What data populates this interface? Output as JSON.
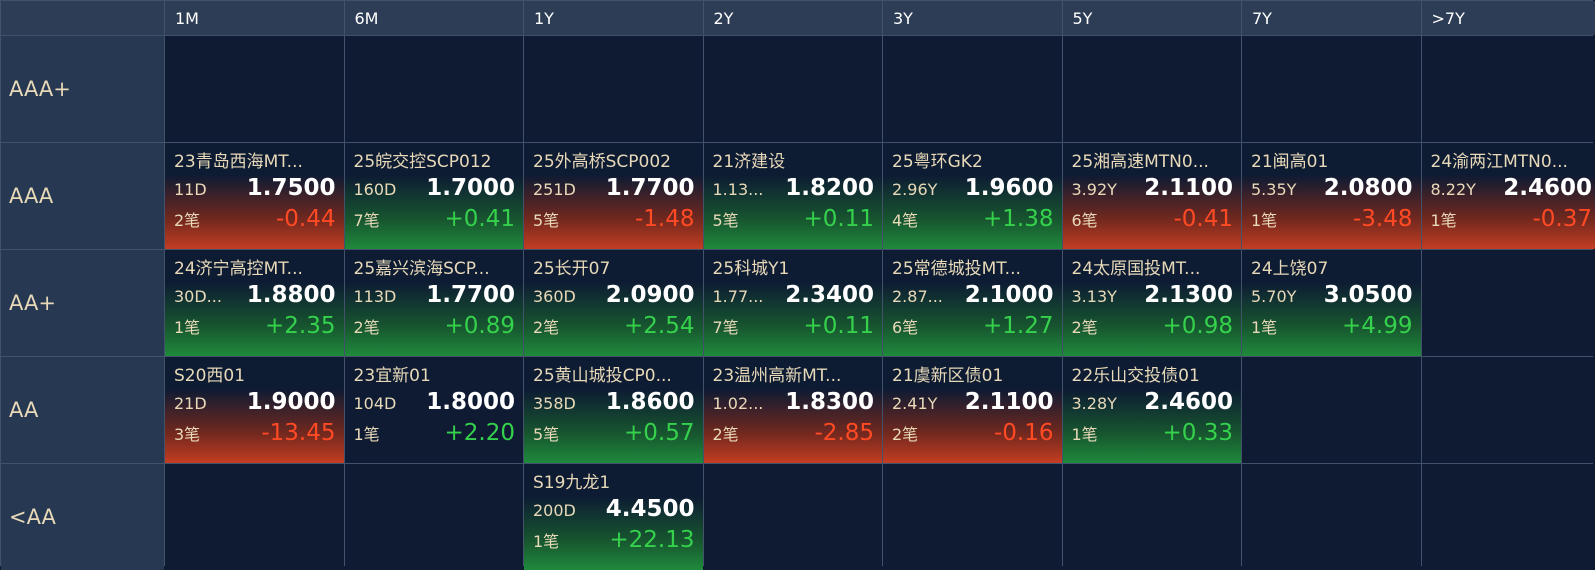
{
  "columns": [
    "1M",
    "6M",
    "1Y",
    "2Y",
    "3Y",
    "5Y",
    "7Y",
    ">7Y"
  ],
  "rows": [
    {
      "label": "AAA+",
      "cells": [
        null,
        null,
        null,
        null,
        null,
        null,
        null,
        null
      ]
    },
    {
      "label": "AAA",
      "cells": [
        {
          "name": "23青岛西海MT...",
          "term": "11D",
          "yield": "1.7500",
          "count": "2笔",
          "change": "-0.44",
          "dir": "down"
        },
        {
          "name": "25皖交控SCP012",
          "term": "160D",
          "yield": "1.7000",
          "count": "7笔",
          "change": "+0.41",
          "dir": "up"
        },
        {
          "name": "25外高桥SCP002",
          "term": "251D",
          "yield": "1.7700",
          "count": "5笔",
          "change": "-1.48",
          "dir": "down"
        },
        {
          "name": "21济建设",
          "term": "1.13...",
          "yield": "1.8200",
          "count": "5笔",
          "change": "+0.11",
          "dir": "up"
        },
        {
          "name": "25粤环GK2",
          "term": "2.96Y",
          "yield": "1.9600",
          "count": "4笔",
          "change": "+1.38",
          "dir": "up"
        },
        {
          "name": "25湘高速MTN0...",
          "term": "3.92Y",
          "yield": "2.1100",
          "count": "6笔",
          "change": "-0.41",
          "dir": "down"
        },
        {
          "name": "21闽高01",
          "term": "5.35Y",
          "yield": "2.0800",
          "count": "1笔",
          "change": "-3.48",
          "dir": "down"
        },
        {
          "name": "24渝两江MTN0...",
          "term": "8.22Y",
          "yield": "2.4600",
          "count": "1笔",
          "change": "-0.37",
          "dir": "down"
        }
      ]
    },
    {
      "label": "AA+",
      "cells": [
        {
          "name": "24济宁高控MT...",
          "term": "30D...",
          "yield": "1.8800",
          "count": "1笔",
          "change": "+2.35",
          "dir": "up"
        },
        {
          "name": "25嘉兴滨海SCP...",
          "term": "113D",
          "yield": "1.7700",
          "count": "2笔",
          "change": "+0.89",
          "dir": "up"
        },
        {
          "name": "25长开07",
          "term": "360D",
          "yield": "2.0900",
          "count": "2笔",
          "change": "+2.54",
          "dir": "up"
        },
        {
          "name": "25科城Y1",
          "term": "1.77...",
          "yield": "2.3400",
          "count": "7笔",
          "change": "+0.11",
          "dir": "up"
        },
        {
          "name": "25常德城投MT...",
          "term": "2.87...",
          "yield": "2.1000",
          "count": "6笔",
          "change": "+1.27",
          "dir": "up"
        },
        {
          "name": "24太原国投MT...",
          "term": "3.13Y",
          "yield": "2.1300",
          "count": "2笔",
          "change": "+0.98",
          "dir": "up"
        },
        {
          "name": "24上饶07",
          "term": "5.70Y",
          "yield": "3.0500",
          "count": "1笔",
          "change": "+4.99",
          "dir": "up"
        },
        null
      ]
    },
    {
      "label": "AA",
      "cells": [
        {
          "name": "S20西01",
          "term": "21D",
          "yield": "1.9000",
          "count": "3笔",
          "change": "-13.45",
          "dir": "down"
        },
        {
          "name": "23宜新01",
          "term": "104D",
          "yield": "1.8000",
          "count": "1笔",
          "change": "+2.20",
          "dir": "none"
        },
        {
          "name": "25黄山城投CP0...",
          "term": "358D",
          "yield": "1.8600",
          "count": "5笔",
          "change": "+0.57",
          "dir": "up"
        },
        {
          "name": "23温州高新MT...",
          "term": "1.02...",
          "yield": "1.8300",
          "count": "2笔",
          "change": "-2.85",
          "dir": "down"
        },
        {
          "name": "21虞新区债01",
          "term": "2.41Y",
          "yield": "2.1100",
          "count": "2笔",
          "change": "-0.16",
          "dir": "down"
        },
        {
          "name": "22乐山交投债01",
          "term": "3.28Y",
          "yield": "2.4600",
          "count": "1笔",
          "change": "+0.33",
          "dir": "up"
        },
        null,
        null
      ]
    },
    {
      "label": "<AA",
      "cells": [
        null,
        null,
        {
          "name": "S19九龙1",
          "term": "200D",
          "yield": "4.4500",
          "count": "1笔",
          "change": "+22.13",
          "dir": "up"
        },
        null,
        null,
        null,
        null,
        null
      ]
    }
  ],
  "colors": {
    "up": "#35d14c",
    "down": "#ff4a24",
    "background": "#0d1a30",
    "header": "#2d3d55"
  }
}
